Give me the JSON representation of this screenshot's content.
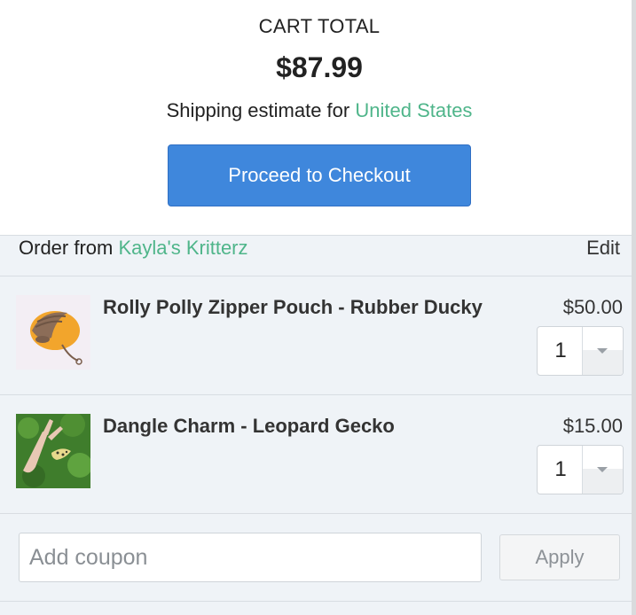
{
  "summary": {
    "cart_total_label": "CART TOTAL",
    "cart_total_amount": "$87.99",
    "shipping_prefix": "Shipping estimate for",
    "shipping_country": "United States",
    "checkout_label": "Proceed to Checkout"
  },
  "order": {
    "prefix": "Order from",
    "shop_name": "Kayla's Kritterz",
    "edit_label": "Edit",
    "items": [
      {
        "title": "Rolly Polly Zipper Pouch - Rubber Ducky",
        "price": "$50.00",
        "quantity": "1"
      },
      {
        "title": "Dangle Charm - Leopard Gecko",
        "price": "$15.00",
        "quantity": "1"
      }
    ],
    "coupon_placeholder": "Add coupon",
    "apply_label": "Apply"
  },
  "colors": {
    "accent_green": "#4fb58a",
    "checkout_blue": "#3f87dc",
    "order_bg": "#eff3f7"
  }
}
